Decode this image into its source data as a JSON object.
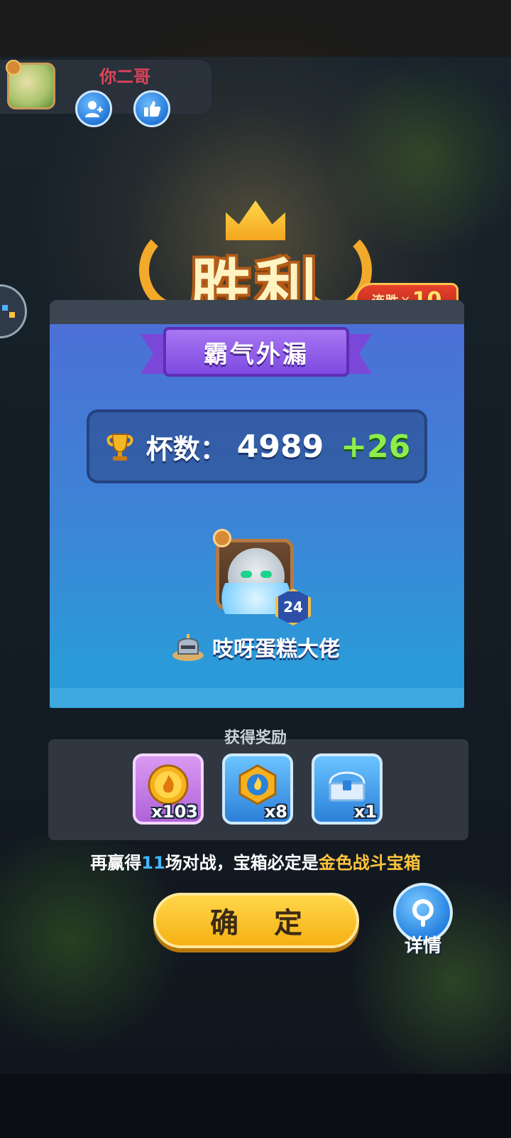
{
  "player": {
    "name": "你二哥"
  },
  "result": {
    "title": "胜利",
    "streak_label": "连胜",
    "streak_multiplier": "×",
    "streak_count": "10"
  },
  "badge_title": "霸气外漏",
  "trophies": {
    "label": "杯数：",
    "value": "4989",
    "delta": "+26"
  },
  "mvp": {
    "level": "24",
    "name": "吱呀蛋糕大佬"
  },
  "rewards": {
    "label": "获得奖励",
    "items": [
      {
        "icon": "coin-icon",
        "count": "x103"
      },
      {
        "icon": "token-icon",
        "count": "x8"
      },
      {
        "icon": "chest-icon",
        "count": "x1"
      }
    ]
  },
  "streak_note": {
    "prefix": "再赢得",
    "number": "11",
    "middle": "场对战，宝箱必定是",
    "highlight": "金色战斗宝箱"
  },
  "buttons": {
    "confirm": "确 定",
    "details": "详情"
  },
  "colors": {
    "accent_gold": "#ffc43d",
    "delta_green": "#8dee4a",
    "name_red": "#e0445a",
    "ribbon_purple": "#7e4ae0"
  }
}
